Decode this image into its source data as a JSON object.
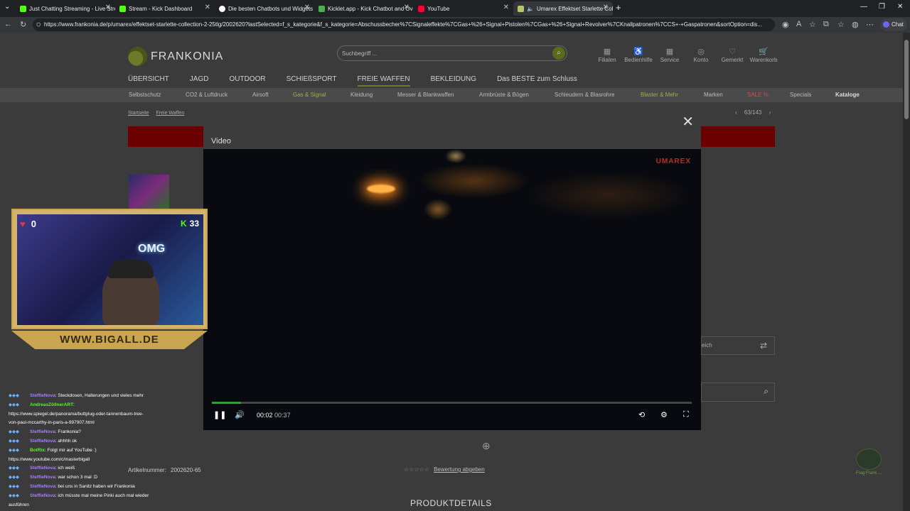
{
  "browser": {
    "tabs": [
      {
        "title": "Just Chatting Streaming - Live Strea",
        "color": "#53fc18"
      },
      {
        "title": "Stream - Kick Dashboard",
        "color": "#53fc18"
      },
      {
        "title": "Die besten Chatbots und Widgets",
        "color": "#ffffff"
      },
      {
        "title": "Kicklet.app - Kick Chatbot and Ov",
        "color": "#4caf50"
      },
      {
        "title": "YouTube",
        "color": "#ff0033"
      },
      {
        "title": "Umarex Effektset Starlette Col",
        "color": "#b6c46a"
      }
    ],
    "url": "https://www.frankonia.de/p/umarex/effektset-starlette-collection-2-25tlg/2002620?lastSelected=f_s_kategorie&f_s_kategorie=Abschussbecher%7CSignaleffekte%7CGas+%26+Signal+Pistolen%7CGas+%26+Signal+Revolver%7CKnallpatronen%7CCS+-+Gaspatronen&sortOption=dis...",
    "chat_label": "Chat"
  },
  "site": {
    "logo": "FRANKONIA",
    "search_placeholder": "Suchbegriff ...",
    "utils": [
      {
        "label": "Filialen",
        "icon": "store-icon"
      },
      {
        "label": "Bedienhilfe",
        "icon": "accessibility-icon"
      },
      {
        "label": "Service",
        "icon": "service-icon"
      },
      {
        "label": "Konto",
        "icon": "account-icon"
      },
      {
        "label": "Gemerkt",
        "icon": "heart-icon"
      },
      {
        "label": "Warenkorb",
        "icon": "cart-icon"
      }
    ],
    "main_nav": [
      "ÜBERSICHT",
      "JAGD",
      "OUTDOOR",
      "SCHIEßSPORT",
      "FREIE WAFFEN",
      "BEKLEIDUNG",
      "Das BESTE zum Schluss"
    ],
    "sub_nav": [
      "Selbstschutz",
      "CO2 & Luftdruck",
      "Airsoft",
      "Gas & Signal",
      "Kleidung",
      "Messer & Blankwaffen",
      "Armbrüste & Bögen",
      "Schleudern & Blasrohre",
      "Blaster & Mehr",
      "Marken",
      "SALE %",
      "Specials",
      "Kataloge"
    ],
    "breadcrumb": [
      "Startseite",
      "Freie Waffen"
    ],
    "pager": "63/143",
    "compare_label": "eich",
    "article_label": "Artikelnummer:",
    "article_number": "2002620-65",
    "rating_link": "Bewertung abgeben",
    "product_details": "PRODUKTDETAILS",
    "helper_label": "Frag Frank ..."
  },
  "modal": {
    "title": "Video",
    "watermark": "UMAREX",
    "time_current": "00:02",
    "time_total": "00:37",
    "progress": 0.06
  },
  "stream_overlay": {
    "heart_rate": "0",
    "viewers": "33",
    "neon_text": "OMG",
    "banner": "WWW.BIGALL.DE",
    "chat": [
      {
        "user": "SteffieNova",
        "msg": ": Steckdosen, Halterungen und vieles mehr",
        "color": "#a97bff"
      },
      {
        "user": "AndreasZöllnerART",
        "msg": ":",
        "color": "#53fc18"
      },
      {
        "user": "",
        "msg": "https://www.spiegel.de/panorama/buttplug-oder-tannenbaum-tree-",
        "color": "#ffffff"
      },
      {
        "user": "",
        "msg": "von-paul-mccarthy-in-paris-a-997907.html",
        "color": "#ffffff"
      },
      {
        "user": "SteffieNova",
        "msg": ": Frankonia?",
        "color": "#a97bff"
      },
      {
        "user": "SteffieNova",
        "msg": ": ahhhh ok",
        "color": "#a97bff"
      },
      {
        "user": "BotRix",
        "msg": ": Folgt mir auf YouTube :)",
        "color": "#53fc18"
      },
      {
        "user": "",
        "msg": "https://www.youtube.com/c/masterbigall",
        "color": "#ffffff"
      },
      {
        "user": "SteffieNova",
        "msg": ": ich weiß",
        "color": "#a97bff"
      },
      {
        "user": "SteffieNova",
        "msg": ": war schon 3 mal :D",
        "color": "#a97bff"
      },
      {
        "user": "SteffieNova",
        "msg": ": bei uns in Sanitz haben wir Frankonia",
        "color": "#a97bff"
      },
      {
        "user": "SteffieNova",
        "msg": ": ich müsste mal meine Pinki auch mal wieder",
        "color": "#a97bff"
      },
      {
        "user": "",
        "msg": "ausführen",
        "color": "#ffffff"
      }
    ]
  }
}
